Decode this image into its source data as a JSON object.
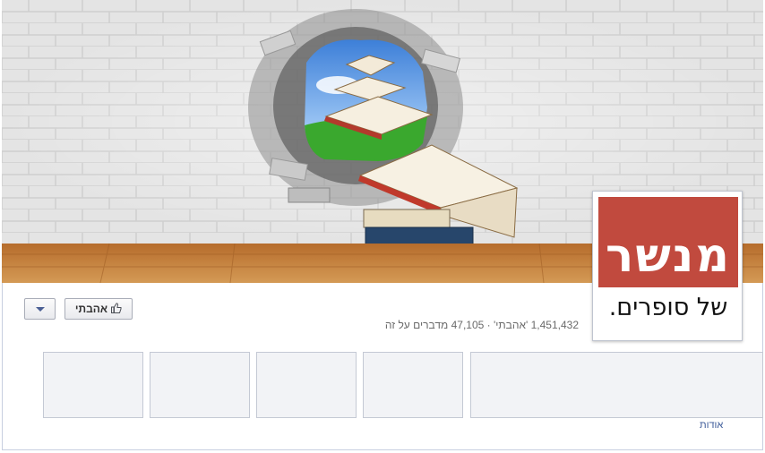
{
  "page": {
    "logo_main": "מנשר",
    "logo_sub": "של סופרים.",
    "like_button_label": "אהבתי",
    "stats": "1,451,432 'אהבתי' · 47,105 מדברים על זה",
    "about_label": "אודות"
  },
  "icons": {
    "like": "thumbs-up-icon",
    "dropdown": "caret-down-icon"
  },
  "colors": {
    "logo_red": "#c14a3e",
    "link_blue": "#3b5998"
  }
}
